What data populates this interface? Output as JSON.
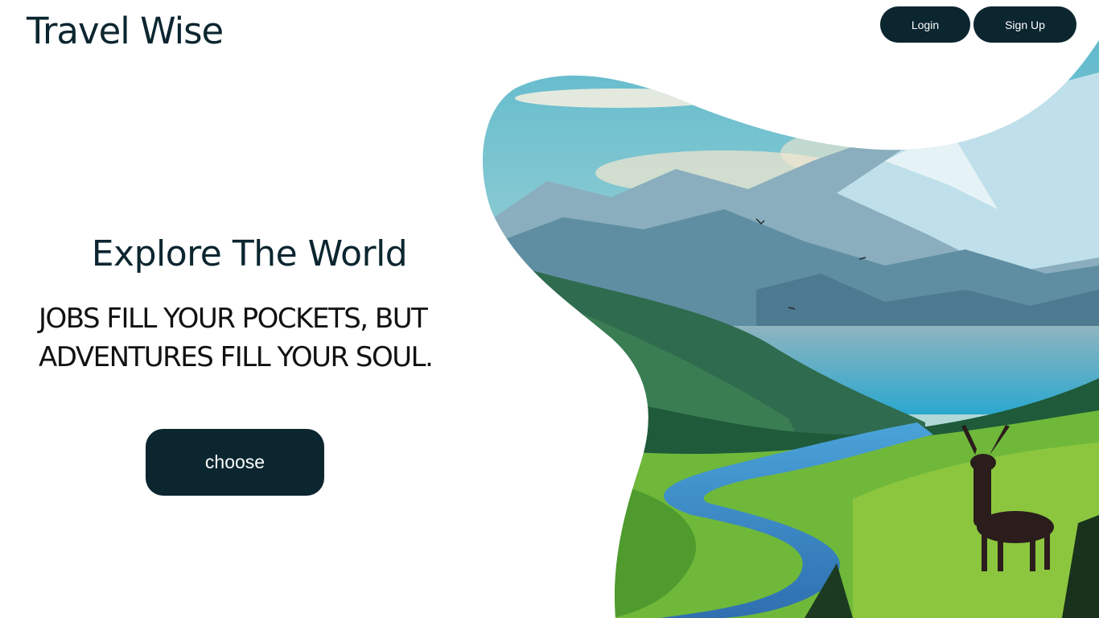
{
  "header": {
    "logo_text": "Travel Wise",
    "login_label": "Login",
    "signup_label": "Sign Up"
  },
  "hero": {
    "title": "Explore The World",
    "quote_line1": "JOBS FILL YOUR POCKETS, BUT",
    "quote_line2": "ADVENTURES FILL YOUR SOUL.",
    "cta_label": "choose"
  },
  "colors": {
    "primary_dark": "#0c2630",
    "background": "#ffffff",
    "button_text": "#ffffff"
  },
  "illustration": {
    "subject": "mountain-landscape-with-deer-and-river"
  }
}
